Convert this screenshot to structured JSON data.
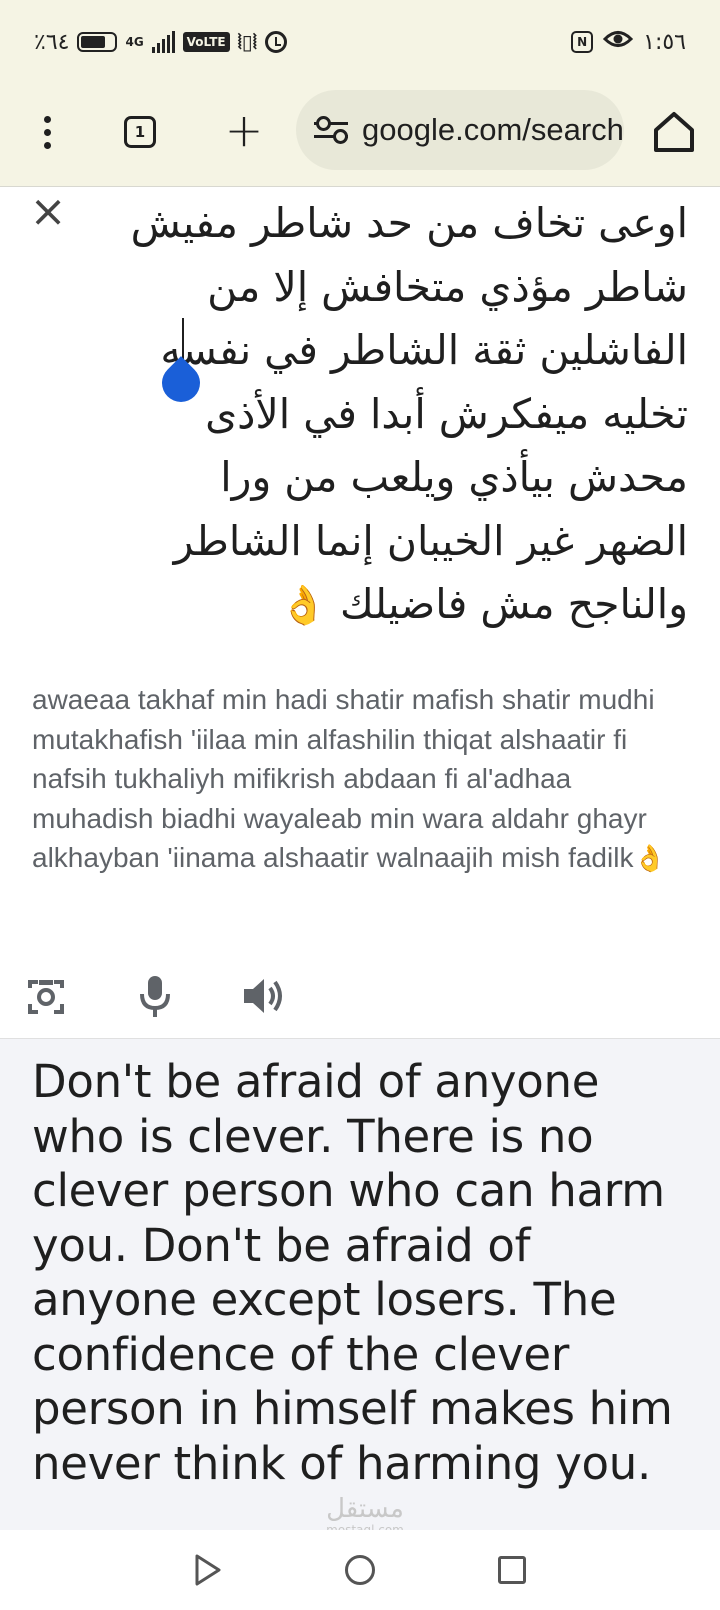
{
  "status_bar": {
    "battery_percent": "٪٦٤",
    "network": "4G",
    "volte": "VoLTE",
    "time": "١:٥٦",
    "nfc": "N"
  },
  "toolbar": {
    "tab_count": "1",
    "url": "google.com/search"
  },
  "input": {
    "source_text": "اوعى تخاف من حد شاطر مفيش شاطر مؤذي متخافش إلا من الفاشلين ثقة الشاطر في نفسه تخليه ميفكرش أبدا في الأذى محدش بيأذي ويلعب من ورا الضهر غير الخيبان إنما الشاطر والناجح مش فاضيلك",
    "source_emoji": "👌",
    "transliteration": "awaeaa takhaf min hadi shatir mafish shatir mudhi mutakhafish 'iilaa min alfashilin thiqat alshaatir fi nafsih tukhaliyh mifikrish abdaan fi al'adhaa muhadish biadhi wayaleab min wara aldahr ghayr alkhayban 'iinama alshaatir walnaajih mish fadilk",
    "transliteration_emoji": "👌"
  },
  "output": {
    "translation": "Don't be afraid of anyone who is clever. There is no clever person who can harm you. Don't be afraid of anyone except losers. The confidence of the clever person in himself makes him never think of harming you."
  },
  "watermark": {
    "arabic": "مستقل",
    "latin": "mostaql.com"
  },
  "icons": {
    "emoji_color": "#e8a500",
    "handle_color": "#1a5fd8"
  }
}
